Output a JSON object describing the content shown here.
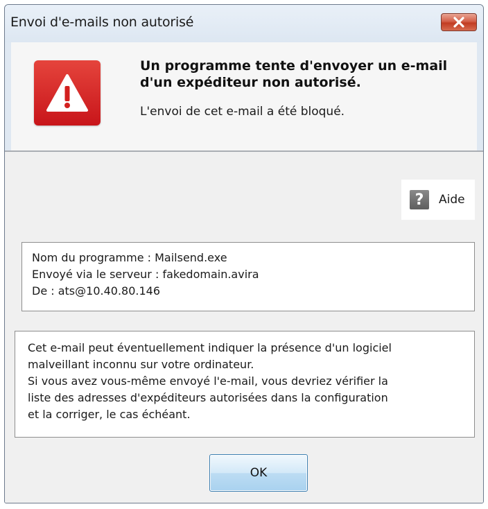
{
  "window": {
    "title": "Envoi d'e-mails non autorisé",
    "close_icon": "close-icon"
  },
  "header": {
    "icon": "warning-icon",
    "title_line1": "Un programme tente d'envoyer un e-mail",
    "title_line2": "d'un expéditeur non autorisé.",
    "subtitle": "L'envoi de cet e-mail a été bloqué."
  },
  "help": {
    "icon": "help-icon",
    "icon_glyph": "?",
    "label": "Aide"
  },
  "details": {
    "program": "Nom du programme : Mailsend.exe",
    "server": "Envoyé via le serveur : fakedomain.avira",
    "from": "De : ats@10.40.80.146"
  },
  "message": {
    "lines": [
      "Cet e-mail peut éventuellement indiquer la présence d'un logiciel",
      "malveillant inconnu sur votre ordinateur.",
      "Si vous avez vous-même envoyé l'e-mail, vous devriez vérifier la",
      "liste des adresses d'expéditeurs autorisées dans la configuration",
      "et la corriger, le cas échéant."
    ]
  },
  "buttons": {
    "ok_label": "OK"
  },
  "colors": {
    "warning_red": "#d3201f",
    "close_red": "#c8432a",
    "ok_border": "#3c7fb1"
  }
}
